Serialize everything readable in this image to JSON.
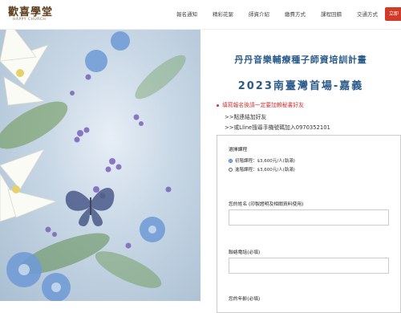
{
  "logo": {
    "main": "歡喜學堂",
    "sub": "HAPPY CHURCH"
  },
  "nav": {
    "items": [
      "報名通知",
      "精彩花絮",
      "師資介紹",
      "繳費方式",
      "課程回饋",
      "交通方式"
    ],
    "register_label": "立即"
  },
  "hero": {
    "title": "丹丹音樂輔療種子師資培訓計畫",
    "subtitle": "2023南臺灣首場-嘉義",
    "notice": "填寫報名後請一定要加賴秘書好友",
    "link_add_friend": ">>點連結加好友",
    "link_line_search": ">>或Lline搜尋手機號碼加入0970352101"
  },
  "form": {
    "course_label": "選擇課程",
    "options": [
      {
        "label": "初階課程：$3,600元/人(執滿)",
        "checked": true
      },
      {
        "label": "進階課程：$3,600元/人(執滿)",
        "checked": false
      }
    ],
    "name_label": "您的姓名 (印製證明及相關資料使用)",
    "phone_label": "聯絡電話(必填)",
    "age_label": "您的年齡(必填)"
  },
  "colors": {
    "title": "#2a5a8a",
    "notice": "#cc3333",
    "register": "#d23a2a"
  }
}
